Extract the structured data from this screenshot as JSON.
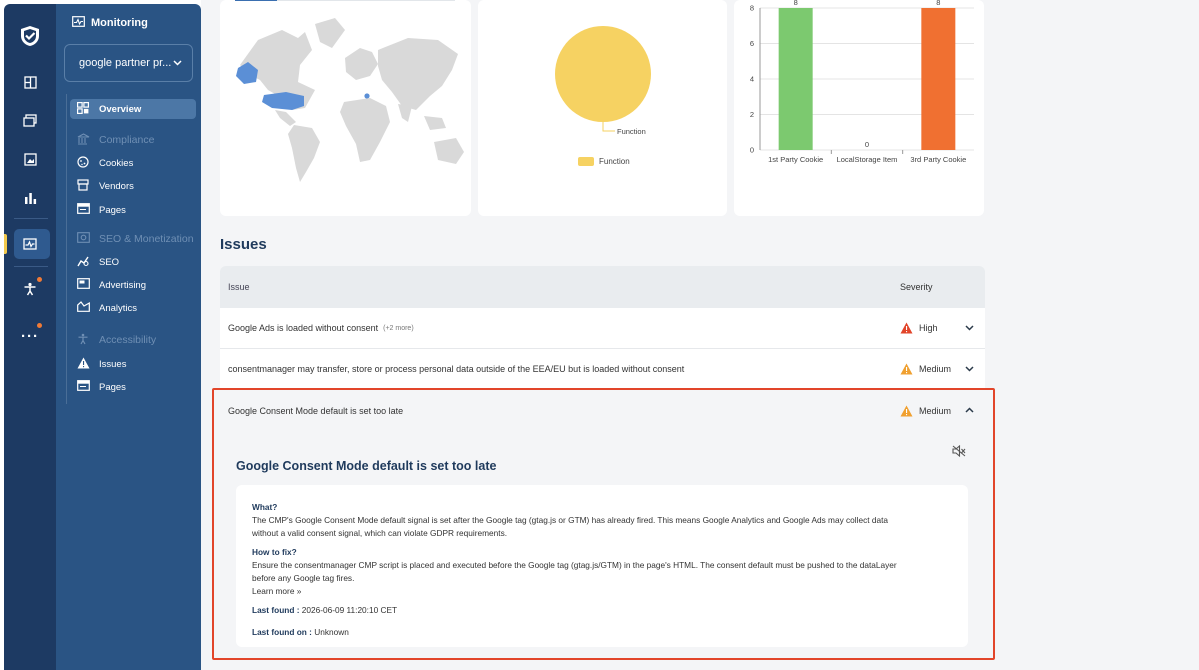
{
  "rail": {
    "icons": [
      "logo-icon",
      "dashboard-icon",
      "folder-icon",
      "image-icon",
      "bar-chart-icon",
      "monitoring-icon",
      "accessibility-icon",
      "more-icon"
    ]
  },
  "sidebar": {
    "section_title": "Monitoring",
    "site_selector": "google partner pr...",
    "items": [
      {
        "label": "Overview",
        "icon": "overview-icon",
        "type": "active"
      },
      {
        "label": "Compliance",
        "icon": "compliance-icon",
        "type": "group"
      },
      {
        "label": "Cookies",
        "icon": "cookie-icon",
        "type": "item"
      },
      {
        "label": "Vendors",
        "icon": "vendor-icon",
        "type": "item"
      },
      {
        "label": "Pages",
        "icon": "pages-icon",
        "type": "item"
      },
      {
        "label": "SEO & Monetization",
        "icon": "seo-group-icon",
        "type": "group"
      },
      {
        "label": "SEO",
        "icon": "seo-icon",
        "type": "item"
      },
      {
        "label": "Advertising",
        "icon": "advertising-icon",
        "type": "item"
      },
      {
        "label": "Analytics",
        "icon": "analytics-icon",
        "type": "item"
      },
      {
        "label": "Accessibility",
        "icon": "accessibility-icon",
        "type": "group"
      },
      {
        "label": "Issues",
        "icon": "warning-icon",
        "type": "item"
      },
      {
        "label": "Pages",
        "icon": "pages-icon",
        "type": "item"
      }
    ]
  },
  "pie_card": {
    "label": "Function",
    "legend": "Function",
    "color": "#f6d262"
  },
  "chart_data": {
    "type": "bar",
    "categories": [
      "1st Party Cookie",
      "LocalStorage Item",
      "3rd Party Cookie"
    ],
    "values": [
      8,
      0,
      8
    ],
    "colors": [
      "#7cc96f",
      "#7cc96f",
      "#f07031"
    ],
    "ylim": [
      0,
      8
    ],
    "yticks": [
      0,
      2,
      4,
      6,
      8
    ],
    "grid": true
  },
  "issues": {
    "title": "Issues",
    "col_issue": "Issue",
    "col_severity": "Severity",
    "rows": [
      {
        "text": "Google Ads is loaded without consent",
        "more": "(+2 more)",
        "severity": "High",
        "sev_color": "#e2452a",
        "chev": "˅"
      },
      {
        "text": "consentmanager may transfer, store or process personal data outside of the EEA/EU but is loaded without consent",
        "more": "",
        "severity": "Medium",
        "sev_color": "#f0a030",
        "chev": "˅"
      },
      {
        "text": "Google Consent Mode default is set too late",
        "more": "",
        "severity": "Medium",
        "sev_color": "#f0a030",
        "chev": "˄"
      }
    ]
  },
  "detail": {
    "title": "Google Consent Mode default is set too late",
    "what_label": "What?",
    "what_text_1": "The CMP's Google Consent Mode default signal is set after the Google tag (gtag.js or GTM) has already fired. This means Google Analytics and Google Ads may collect data",
    "what_text_2": "without a valid consent signal, which can violate GDPR requirements.",
    "fix_label": "How to fix?",
    "fix_text_1": "Ensure the consentmanager CMP script is placed and executed before the Google tag (gtag.js/GTM) in the page's HTML. The consent default must be pushed to the dataLayer",
    "fix_text_2": "before any Google tag fires.",
    "learn_more": "Learn more »",
    "last_found_label": "Last found :",
    "last_found_value": "2026-06-09 11:20:10 CET",
    "last_found_on_label": "Last found on :",
    "last_found_on_value": "Unknown"
  }
}
